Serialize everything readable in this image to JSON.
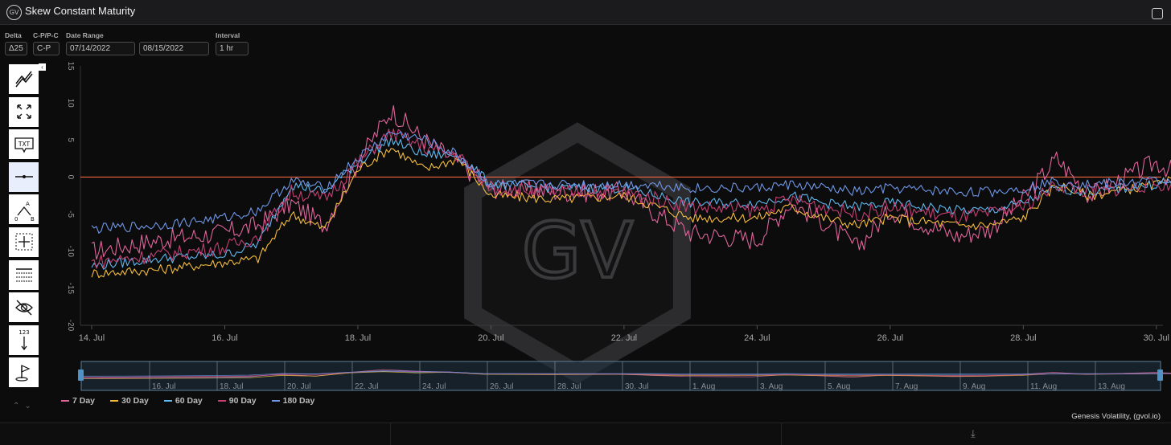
{
  "app": {
    "logo_text": "GV",
    "title": "Skew Constant Maturity"
  },
  "controls": [
    {
      "id": "delta",
      "label": "Delta",
      "value": "Δ25"
    },
    {
      "id": "cp",
      "label": "C-P/P-C",
      "value": "C-P"
    },
    {
      "id": "date_start",
      "label": "Date Range",
      "value": "07/14/2022"
    },
    {
      "id": "date_end",
      "label": "",
      "value": "08/15/2022"
    },
    {
      "id": "interval",
      "label": "Interval",
      "value": "1 hr"
    }
  ],
  "toolbar": {
    "tools": [
      "trend-line-tool",
      "fullscreen-tool",
      "text-annotation-tool",
      "horizontal-line-tool",
      "measure-ab-tool",
      "crosshair-tool",
      "table-tool",
      "hide-tool",
      "value-label-tool",
      "flag-tool"
    ],
    "text_tool_label": "TXT",
    "measure_a": "A",
    "measure_b": "B",
    "measure_zero": "0",
    "value_label": "123"
  },
  "colors": {
    "d7": "#e0649a",
    "d30": "#f3bb3c",
    "d60": "#5fb8ee",
    "d90": "#c53f73",
    "d180": "#6f97e6",
    "zero_line": "#f2653f"
  },
  "watermark": "GV",
  "credits": "Genesis Volatility, (gvol.io)",
  "chart_data": {
    "type": "line",
    "title": "Skew Constant Maturity",
    "ylim": [
      -20,
      15
    ],
    "y_ticks": [
      "15",
      "10",
      "5",
      "0",
      "-5",
      "-10",
      "-15",
      "-20"
    ],
    "x_range": [
      "2022-07-14",
      "2022-08-15"
    ],
    "x_ticks": [
      "14. Jul",
      "16. Jul",
      "18. Jul",
      "20. Jul",
      "22. Jul",
      "24. Jul",
      "26. Jul",
      "28. Jul",
      "30. Jul",
      "1. Aug",
      "3. Aug",
      "5. Aug",
      "7. Aug",
      "9. Aug",
      "11. Aug",
      "13. Aug",
      "15. Aug"
    ],
    "navigator_ticks": [
      "16. Jul",
      "18. Jul",
      "20. Jul",
      "22. Jul",
      "24. Jul",
      "26. Jul",
      "28. Jul",
      "30. Jul",
      "1. Aug",
      "3. Aug",
      "5. Aug",
      "7. Aug",
      "9. Aug",
      "11. Aug",
      "13. Aug"
    ],
    "reference_line": 0,
    "grid": false,
    "legend_placement": "bottom-left",
    "series": [
      {
        "name": "7 Day",
        "color": "#e0649a",
        "points": [
          [
            "2022-07-14",
            -10.0
          ],
          [
            "2022-07-15",
            -8.5
          ],
          [
            "2022-07-16",
            -7.5
          ],
          [
            "2022-07-16T12",
            -6.5
          ],
          [
            "2022-07-17",
            -3.5
          ],
          [
            "2022-07-17T12",
            -6.5
          ],
          [
            "2022-07-18",
            2.0
          ],
          [
            "2022-07-18T12",
            9.0
          ],
          [
            "2022-07-19",
            5.0
          ],
          [
            "2022-07-19T12",
            2.0
          ],
          [
            "2022-07-20",
            -1.5
          ],
          [
            "2022-07-21",
            -2.0
          ],
          [
            "2022-07-22",
            -2.0
          ],
          [
            "2022-07-22T12",
            -5.0
          ],
          [
            "2022-07-23",
            -7.5
          ],
          [
            "2022-07-24",
            -8.5
          ],
          [
            "2022-07-24T12",
            -3.5
          ],
          [
            "2022-07-25",
            -6.0
          ],
          [
            "2022-07-25T12",
            -9.5
          ],
          [
            "2022-07-26",
            -4.5
          ],
          [
            "2022-07-27",
            -8.0
          ],
          [
            "2022-07-27T12",
            -7.0
          ],
          [
            "2022-07-28",
            -3.0
          ],
          [
            "2022-07-28T12",
            2.5
          ],
          [
            "2022-07-29",
            -2.5
          ],
          [
            "2022-07-30",
            2.0
          ],
          [
            "2022-07-30T12",
            -0.5
          ],
          [
            "2022-07-31",
            -1.5
          ],
          [
            "2022-08-01",
            -4.0
          ],
          [
            "2022-08-02",
            -6.0
          ],
          [
            "2022-08-03",
            -5.5
          ],
          [
            "2022-08-04",
            -5.0
          ],
          [
            "2022-08-05",
            -3.0
          ],
          [
            "2022-08-06",
            -2.0
          ],
          [
            "2022-08-07",
            -3.0
          ],
          [
            "2022-08-08",
            -2.0
          ],
          [
            "2022-08-08T12",
            0.5
          ],
          [
            "2022-08-09",
            -4.0
          ],
          [
            "2022-08-10",
            -3.0
          ],
          [
            "2022-08-11",
            -3.0
          ],
          [
            "2022-08-12",
            -4.0
          ],
          [
            "2022-08-13",
            -3.5
          ],
          [
            "2022-08-14",
            -4.0
          ],
          [
            "2022-08-15",
            -6.5
          ]
        ]
      },
      {
        "name": "30 Day",
        "color": "#f3bb3c",
        "points": [
          [
            "2022-07-14",
            -13.0
          ],
          [
            "2022-07-15",
            -12.5
          ],
          [
            "2022-07-16",
            -11.5
          ],
          [
            "2022-07-16T12",
            -11.0
          ],
          [
            "2022-07-17",
            -5.0
          ],
          [
            "2022-07-17T12",
            -7.0
          ],
          [
            "2022-07-18",
            1.0
          ],
          [
            "2022-07-18T12",
            4.0
          ],
          [
            "2022-07-19",
            1.0
          ],
          [
            "2022-07-19T12",
            2.5
          ],
          [
            "2022-07-20",
            -2.5
          ],
          [
            "2022-07-21",
            -3.0
          ],
          [
            "2022-07-22",
            -2.5
          ],
          [
            "2022-07-22T12",
            -4.0
          ],
          [
            "2022-07-23",
            -5.5
          ],
          [
            "2022-07-24",
            -5.5
          ],
          [
            "2022-07-24T12",
            -4.0
          ],
          [
            "2022-07-25",
            -5.5
          ],
          [
            "2022-07-25T12",
            -6.5
          ],
          [
            "2022-07-26",
            -5.5
          ],
          [
            "2022-07-27",
            -6.5
          ],
          [
            "2022-07-27T12",
            -6.5
          ],
          [
            "2022-07-28",
            -5.5
          ],
          [
            "2022-07-28T12",
            -1.0
          ],
          [
            "2022-07-29",
            -2.5
          ],
          [
            "2022-07-30",
            -1.0
          ],
          [
            "2022-07-30T12",
            0.0
          ],
          [
            "2022-07-31",
            -1.5
          ],
          [
            "2022-08-01",
            -3.5
          ],
          [
            "2022-08-02",
            -6.5
          ],
          [
            "2022-08-03",
            -8.0
          ],
          [
            "2022-08-04",
            -7.0
          ],
          [
            "2022-08-05",
            -5.0
          ],
          [
            "2022-08-06",
            -4.0
          ],
          [
            "2022-08-07",
            -3.5
          ],
          [
            "2022-08-08",
            -3.5
          ],
          [
            "2022-08-08T12",
            -2.5
          ],
          [
            "2022-08-09",
            -3.0
          ],
          [
            "2022-08-10",
            -2.5
          ],
          [
            "2022-08-11",
            -3.0
          ],
          [
            "2022-08-12",
            -3.5
          ],
          [
            "2022-08-13",
            -3.0
          ],
          [
            "2022-08-14",
            -3.5
          ],
          [
            "2022-08-15",
            -4.0
          ]
        ]
      },
      {
        "name": "60 Day",
        "color": "#5fb8ee",
        "points": [
          [
            "2022-07-14",
            -12.0
          ],
          [
            "2022-07-15",
            -11.0
          ],
          [
            "2022-07-16",
            -10.5
          ],
          [
            "2022-07-16T12",
            -9.0
          ],
          [
            "2022-07-17",
            -1.0
          ],
          [
            "2022-07-17T12",
            -2.0
          ],
          [
            "2022-07-18",
            2.0
          ],
          [
            "2022-07-18T12",
            5.0
          ],
          [
            "2022-07-19",
            3.0
          ],
          [
            "2022-07-19T12",
            3.0
          ],
          [
            "2022-07-20",
            -1.0
          ],
          [
            "2022-07-21",
            -1.5
          ],
          [
            "2022-07-22",
            -1.5
          ],
          [
            "2022-07-22T12",
            -2.5
          ],
          [
            "2022-07-23",
            -3.5
          ],
          [
            "2022-07-24",
            -3.5
          ],
          [
            "2022-07-24T12",
            -2.5
          ],
          [
            "2022-07-25",
            -3.5
          ],
          [
            "2022-07-25T12",
            -4.0
          ],
          [
            "2022-07-26",
            -3.5
          ],
          [
            "2022-07-27",
            -4.5
          ],
          [
            "2022-07-27T12",
            -4.5
          ],
          [
            "2022-07-28",
            -3.5
          ],
          [
            "2022-07-28T12",
            -1.5
          ],
          [
            "2022-07-29",
            -2.0
          ],
          [
            "2022-07-30",
            -1.0
          ],
          [
            "2022-07-30T12",
            -0.5
          ],
          [
            "2022-07-31",
            -1.0
          ],
          [
            "2022-08-01",
            -4.0
          ],
          [
            "2022-08-02",
            -6.0
          ],
          [
            "2022-08-03",
            -7.5
          ],
          [
            "2022-08-04",
            -6.5
          ],
          [
            "2022-08-05",
            -4.5
          ],
          [
            "2022-08-06",
            -4.0
          ],
          [
            "2022-08-07",
            -4.0
          ],
          [
            "2022-08-08",
            -3.5
          ],
          [
            "2022-08-08T12",
            -3.0
          ],
          [
            "2022-08-09",
            -3.5
          ],
          [
            "2022-08-10",
            -3.0
          ],
          [
            "2022-08-11",
            -3.5
          ],
          [
            "2022-08-12",
            -4.0
          ],
          [
            "2022-08-13",
            -4.0
          ],
          [
            "2022-08-14",
            -4.0
          ],
          [
            "2022-08-15",
            -4.5
          ]
        ]
      },
      {
        "name": "90 Day",
        "color": "#c53f73",
        "points": [
          [
            "2022-07-14",
            -11.5
          ],
          [
            "2022-07-15",
            -10.5
          ],
          [
            "2022-07-16",
            -9.5
          ],
          [
            "2022-07-16T12",
            -8.0
          ],
          [
            "2022-07-17",
            -2.0
          ],
          [
            "2022-07-17T12",
            -3.0
          ],
          [
            "2022-07-18",
            2.0
          ],
          [
            "2022-07-18T12",
            6.0
          ],
          [
            "2022-07-19",
            4.0
          ],
          [
            "2022-07-19T12",
            3.0
          ],
          [
            "2022-07-20",
            -1.5
          ],
          [
            "2022-07-21",
            -2.0
          ],
          [
            "2022-07-22",
            -2.0
          ],
          [
            "2022-07-22T12",
            -3.0
          ],
          [
            "2022-07-23",
            -4.0
          ],
          [
            "2022-07-24",
            -4.5
          ],
          [
            "2022-07-24T12",
            -3.0
          ],
          [
            "2022-07-25",
            -4.0
          ],
          [
            "2022-07-25T12",
            -5.0
          ],
          [
            "2022-07-26",
            -4.0
          ],
          [
            "2022-07-27",
            -5.5
          ],
          [
            "2022-07-27T12",
            -5.0
          ],
          [
            "2022-07-28",
            -4.0
          ],
          [
            "2022-07-28T12",
            -1.0
          ],
          [
            "2022-07-29",
            -2.0
          ],
          [
            "2022-07-30",
            -1.0
          ],
          [
            "2022-07-30T12",
            -1.0
          ],
          [
            "2022-07-31",
            -1.5
          ],
          [
            "2022-08-01",
            -3.5
          ],
          [
            "2022-08-02",
            -5.0
          ],
          [
            "2022-08-03",
            -5.5
          ],
          [
            "2022-08-04",
            -5.0
          ],
          [
            "2022-08-05",
            -4.0
          ],
          [
            "2022-08-06",
            -3.0
          ],
          [
            "2022-08-07",
            -3.0
          ],
          [
            "2022-08-08",
            -3.0
          ],
          [
            "2022-08-08T12",
            -2.0
          ],
          [
            "2022-08-09",
            -3.0
          ],
          [
            "2022-08-10",
            -2.5
          ],
          [
            "2022-08-11",
            -3.0
          ],
          [
            "2022-08-12",
            -3.0
          ],
          [
            "2022-08-13",
            -3.0
          ],
          [
            "2022-08-14",
            -3.5
          ],
          [
            "2022-08-15",
            -4.0
          ]
        ]
      },
      {
        "name": "180 Day",
        "color": "#6f97e6",
        "points": [
          [
            "2022-07-14",
            -7.0
          ],
          [
            "2022-07-15",
            -6.5
          ],
          [
            "2022-07-16",
            -5.5
          ],
          [
            "2022-07-16T12",
            -4.5
          ],
          [
            "2022-07-17",
            -0.5
          ],
          [
            "2022-07-17T12",
            -1.5
          ],
          [
            "2022-07-18",
            2.5
          ],
          [
            "2022-07-18T12",
            6.0
          ],
          [
            "2022-07-19",
            5.0
          ],
          [
            "2022-07-19T12",
            3.0
          ],
          [
            "2022-07-20",
            -1.0
          ],
          [
            "2022-07-21",
            -1.0
          ],
          [
            "2022-07-22",
            -1.0
          ],
          [
            "2022-07-22T12",
            -1.0
          ],
          [
            "2022-07-23",
            -1.5
          ],
          [
            "2022-07-24",
            -1.5
          ],
          [
            "2022-07-24T12",
            -1.0
          ],
          [
            "2022-07-25",
            -1.5
          ],
          [
            "2022-07-25T12",
            -2.0
          ],
          [
            "2022-07-26",
            -1.5
          ],
          [
            "2022-07-27",
            -2.0
          ],
          [
            "2022-07-27T12",
            -2.0
          ],
          [
            "2022-07-28",
            -1.5
          ],
          [
            "2022-07-28T12",
            -0.5
          ],
          [
            "2022-07-29",
            -1.0
          ],
          [
            "2022-07-30",
            -0.5
          ],
          [
            "2022-07-30T12",
            -0.5
          ],
          [
            "2022-07-31",
            -1.0
          ],
          [
            "2022-08-01",
            -2.5
          ],
          [
            "2022-08-02",
            -3.5
          ],
          [
            "2022-08-03",
            -4.0
          ],
          [
            "2022-08-04",
            -3.5
          ],
          [
            "2022-08-05",
            -2.5
          ],
          [
            "2022-08-06",
            -2.0
          ],
          [
            "2022-08-07",
            -2.0
          ],
          [
            "2022-08-08",
            -2.0
          ],
          [
            "2022-08-08T12",
            -1.5
          ],
          [
            "2022-08-09",
            -1.5
          ],
          [
            "2022-08-10",
            -1.5
          ],
          [
            "2022-08-11",
            -1.0
          ],
          [
            "2022-08-12",
            -1.0
          ],
          [
            "2022-08-13",
            -1.5
          ],
          [
            "2022-08-14",
            -1.5
          ],
          [
            "2022-08-15",
            -1.5
          ]
        ]
      }
    ]
  }
}
